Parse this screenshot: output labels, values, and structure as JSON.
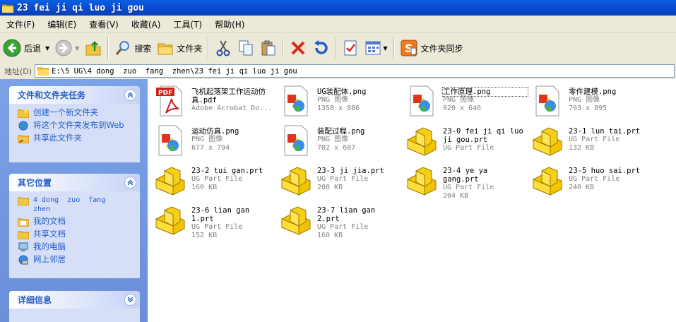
{
  "window": {
    "title": "23 fei ji qi luo ji gou"
  },
  "menu": [
    "文件(F)",
    "编辑(E)",
    "查看(V)",
    "收藏(A)",
    "工具(T)",
    "帮助(H)"
  ],
  "toolbar": {
    "back": "后退",
    "search": "搜索",
    "folders": "文件夹",
    "sync": "文件夹同步"
  },
  "address": {
    "label": "地址(D)",
    "path": "E:\\5 UG\\4 dong  zuo  fang  zhen\\23 fei ji qi luo ji gou"
  },
  "sidebar": {
    "tasks": {
      "title": "文件和文件夹任务",
      "items": [
        "创建一个新文件夹",
        "将这个文件夹发布到Web",
        "共享此文件夹"
      ]
    },
    "places": {
      "title": "其它位置",
      "items": [
        "4 dong  zuo  fang zhen",
        "我的文档",
        "共享文档",
        "我的电脑",
        "网上邻居"
      ]
    },
    "details": {
      "title": "详细信息"
    }
  },
  "files": [
    {
      "name": "飞机起落架工作运动仿真.pdf",
      "type": "Adobe Acrobat Do...",
      "info": "",
      "icon": "pdf-icon"
    },
    {
      "name": "UG装配体.png",
      "type": "PNG 图像",
      "info": "1358 x 886",
      "icon": "png-icon"
    },
    {
      "name": "工作原理.png",
      "type": "PNG 图像",
      "info": "920 x 646",
      "icon": "png-icon"
    },
    {
      "name": "零件建模.png",
      "type": "PNG 图像",
      "info": "703 x 895",
      "icon": "png-icon"
    },
    {
      "name": "运动仿真.png",
      "type": "PNG 图像",
      "info": "677 x 794",
      "icon": "png-icon"
    },
    {
      "name": "装配过程.png",
      "type": "PNG 图像",
      "info": "702 x 607",
      "icon": "png-icon"
    },
    {
      "name": "23-0 fei ji qi luo ji gou.prt",
      "type": "UG Part File",
      "info": "",
      "icon": "prt-icon"
    },
    {
      "name": "23-1 lun tai.prt",
      "type": "UG Part File",
      "info": "132 KB",
      "icon": "prt-icon"
    },
    {
      "name": "23-2 tui gan.prt",
      "type": "UG Part File",
      "info": "160 KB",
      "icon": "prt-icon"
    },
    {
      "name": "23-3 ji jia.prt",
      "type": "UG Part File",
      "info": "208 KB",
      "icon": "prt-icon"
    },
    {
      "name": "23-4 ye ya gang.prt",
      "type": "UG Part File",
      "info": "204 KB",
      "icon": "prt-icon"
    },
    {
      "name": "23-5 huo sai.prt",
      "type": "UG Part File",
      "info": "240 KB",
      "icon": "prt-icon"
    },
    {
      "name": "23-6 lian gan 1.prt",
      "type": "UG Part File",
      "info": "152 KB",
      "icon": "prt-icon"
    },
    {
      "name": "23-7 lian gan 2.prt",
      "type": "UG Part File",
      "info": "160 KB",
      "icon": "prt-icon"
    }
  ],
  "colors": {
    "title_bar": "#0b4fd6",
    "sidebar_bg": "#7ba2e7",
    "link": "#215dc6",
    "chrome": "#ece9d8"
  }
}
